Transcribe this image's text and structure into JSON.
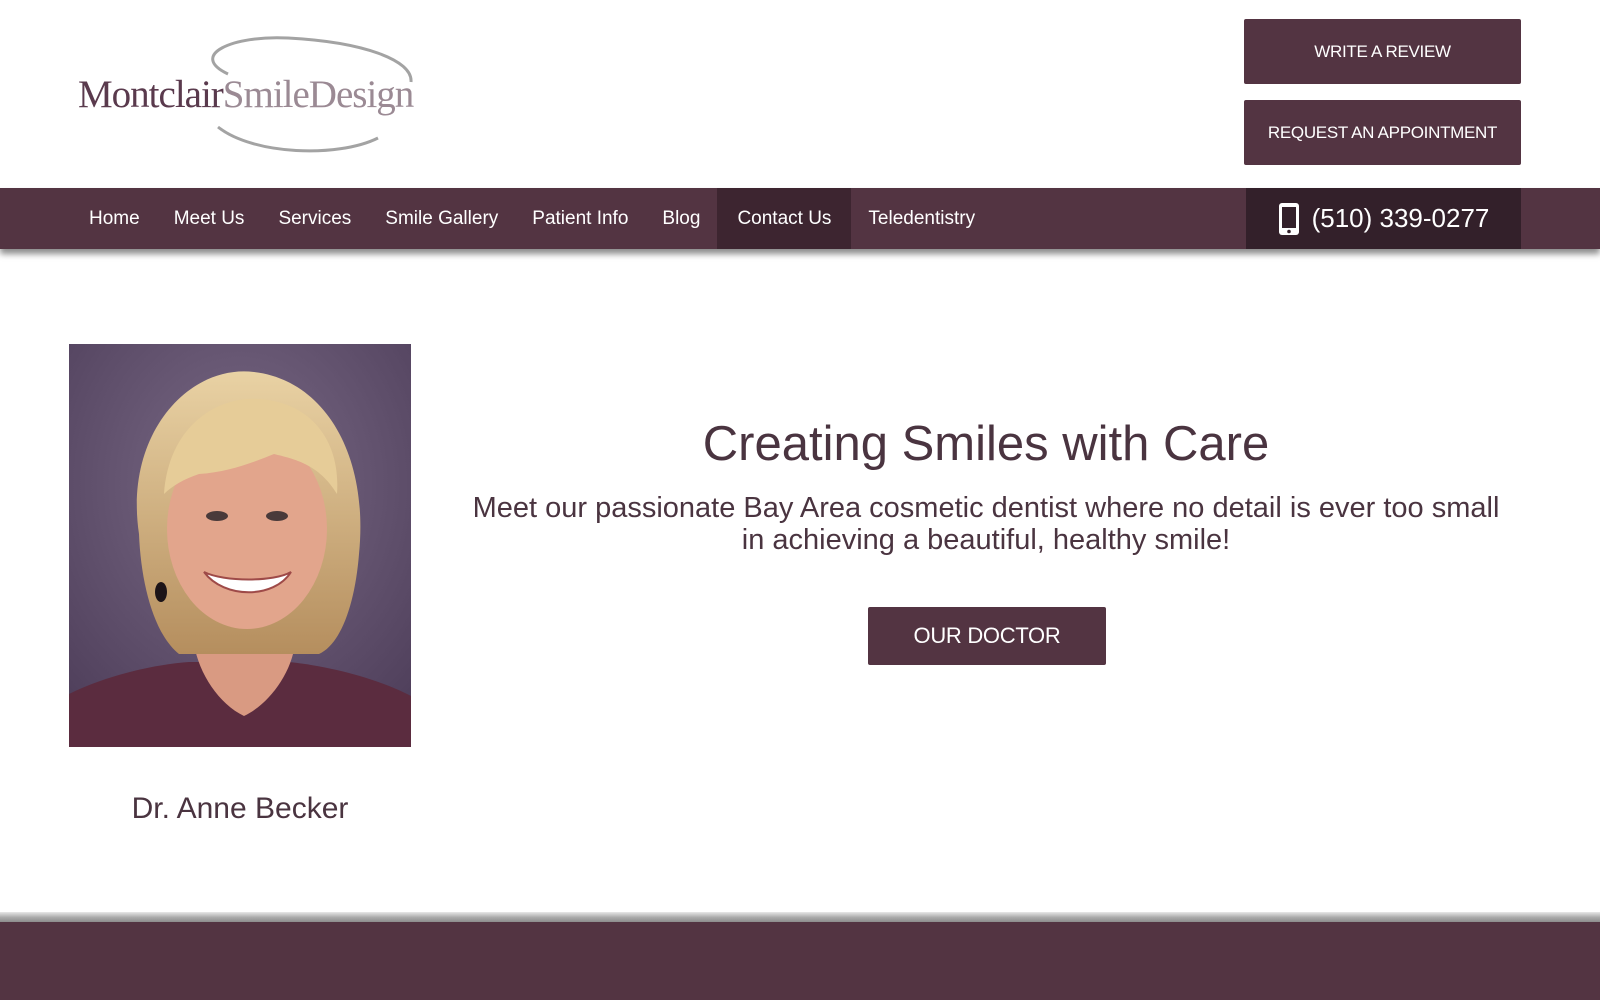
{
  "header": {
    "logo": {
      "word1": "Montclair",
      "word2": "SmileDesign"
    },
    "buttons": {
      "review": "WRITE A REVIEW",
      "appointment": "REQUEST AN APPOINTMENT"
    }
  },
  "nav": {
    "items": [
      {
        "label": "Home"
      },
      {
        "label": "Meet Us"
      },
      {
        "label": "Services"
      },
      {
        "label": "Smile Gallery"
      },
      {
        "label": "Patient Info"
      },
      {
        "label": "Blog"
      },
      {
        "label": "Contact Us",
        "active": true
      },
      {
        "label": "Teledentistry"
      }
    ],
    "phone": "(510) 339-0277",
    "phone_icon": "mobile-phone-icon"
  },
  "main": {
    "doctor_name": "Dr. Anne Becker",
    "hero_title": "Creating Smiles with Care",
    "hero_subtitle": "Meet our passionate Bay Area cosmetic dentist where no detail is ever too small in achieving a beautiful, healthy smile!",
    "cta_label": "OUR DOCTOR"
  },
  "colors": {
    "brand": "#533442",
    "brand_dark": "#33202a",
    "text": "#4a3440",
    "logo_light": "#9b8a94"
  }
}
